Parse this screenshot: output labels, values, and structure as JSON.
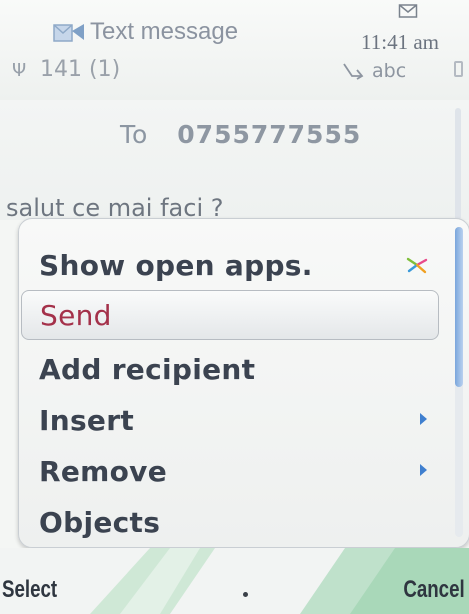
{
  "status": {
    "app_title": "Text message",
    "time": "11:41 am",
    "counter": "141 (1)",
    "input_mode": "abc"
  },
  "editor": {
    "to_label": "To",
    "to_value": "0755777555",
    "body_text": "salut ce mai faci ?"
  },
  "menu": {
    "items": [
      {
        "label": "Show open apps.",
        "icon": "open-apps-icon",
        "selected": false,
        "submenu": false
      },
      {
        "label": "Send",
        "selected": true,
        "submenu": false
      },
      {
        "label": "Add recipient",
        "selected": false,
        "submenu": false
      },
      {
        "label": "Insert",
        "selected": false,
        "submenu": true
      },
      {
        "label": "Remove",
        "selected": false,
        "submenu": true
      },
      {
        "label": "Objects",
        "selected": false,
        "submenu": false
      }
    ]
  },
  "softkeys": {
    "left": "Select",
    "right": "Cancel"
  },
  "colors": {
    "selected_text": "#a4314a",
    "submenu_arrow": "#3f7fcf"
  }
}
